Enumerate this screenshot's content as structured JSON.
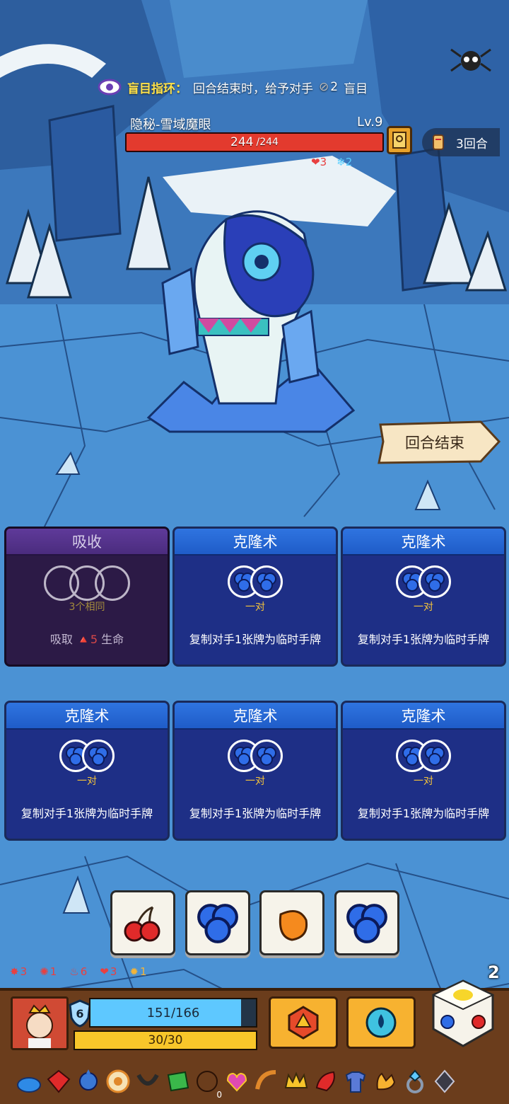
{
  "buff": {
    "name": "盲目指环：",
    "description": "回合结束时，给予对手",
    "amount": "2",
    "effect": "盲目"
  },
  "enemy": {
    "name": "隐秘-雪域魔眼",
    "level": "Lv.9",
    "hp_current": "244",
    "hp_max": "/244",
    "hp_fraction": 1.0,
    "status": [
      {
        "icon": "broken-heart-icon",
        "value": "3",
        "color": "#e84040"
      },
      {
        "icon": "snowflake-icon",
        "value": "2",
        "color": "#5cd0ff"
      }
    ]
  },
  "turn": {
    "label": "3回合"
  },
  "end_turn_label": "回合结束",
  "cards": [
    {
      "title": "吸收",
      "requirement": "3个相同",
      "desc_prefix": "吸取",
      "desc_num": "5",
      "desc_suffix": "生命",
      "variant": "absorb"
    },
    {
      "title": "克隆术",
      "requirement": "一对",
      "description": "复制对手1张牌为临时手牌",
      "variant": "clone"
    },
    {
      "title": "克隆术",
      "requirement": "一对",
      "description": "复制对手1张牌为临时手牌",
      "variant": "clone"
    },
    {
      "title": "克隆术",
      "requirement": "一对",
      "description": "复制对手1张牌为临时手牌",
      "variant": "clone"
    },
    {
      "title": "克隆术",
      "requirement": "一对",
      "description": "复制对手1张牌为临时手牌",
      "variant": "clone"
    },
    {
      "title": "克隆术",
      "requirement": "一对",
      "description": "复制对手1张牌为临时手牌",
      "variant": "clone"
    }
  ],
  "dice": [
    {
      "icon": "cherry-icon"
    },
    {
      "icon": "blueberry-icon"
    },
    {
      "icon": "orange-icon"
    },
    {
      "icon": "blueberry-icon"
    }
  ],
  "player_status": [
    {
      "icon": "bleed-icon",
      "value": "3"
    },
    {
      "icon": "burst-icon",
      "value": "1"
    },
    {
      "icon": "claw-icon",
      "value": "6"
    },
    {
      "icon": "heart-break-icon",
      "value": "3"
    },
    {
      "icon": "flame-icon",
      "value": "1"
    }
  ],
  "dice_remaining": "2",
  "player": {
    "shield": "6",
    "hp_text": "151/166",
    "hp_fraction": 0.91,
    "xp_text": "30/30",
    "xp_fraction": 1.0
  },
  "relic_count_badge": "0",
  "colors": {
    "card_blue": "#1e2f86",
    "card_head": "#2f74e0",
    "absorb_purple": "#2c1a46",
    "hp_red": "#e33a2e",
    "mana_cyan": "#5ec8ff",
    "xp_yellow": "#f8c62a",
    "panel_brown": "#6b3d1c"
  }
}
